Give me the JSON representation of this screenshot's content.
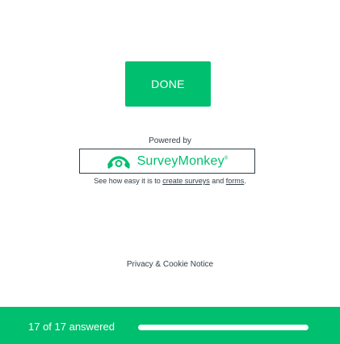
{
  "done_button": {
    "label": "DONE"
  },
  "branding": {
    "powered_by": "Powered by",
    "logo_icon": "surveymonkey-logo-icon",
    "logo_text": "SurveyMonkey",
    "logo_tm": "®"
  },
  "promo": {
    "prefix": "See how easy it is to ",
    "create_link": "create surveys",
    "middle": " and ",
    "forms_link": "forms",
    "suffix": "."
  },
  "footer_links": {
    "privacy": "Privacy & Cookie Notice"
  },
  "progress": {
    "text": "17 of 17 answered",
    "answered": 17,
    "total": 17,
    "fraction": 1.0
  },
  "colors": {
    "brand_green": "#00bf6f",
    "text": "#333e48",
    "white": "#ffffff"
  }
}
